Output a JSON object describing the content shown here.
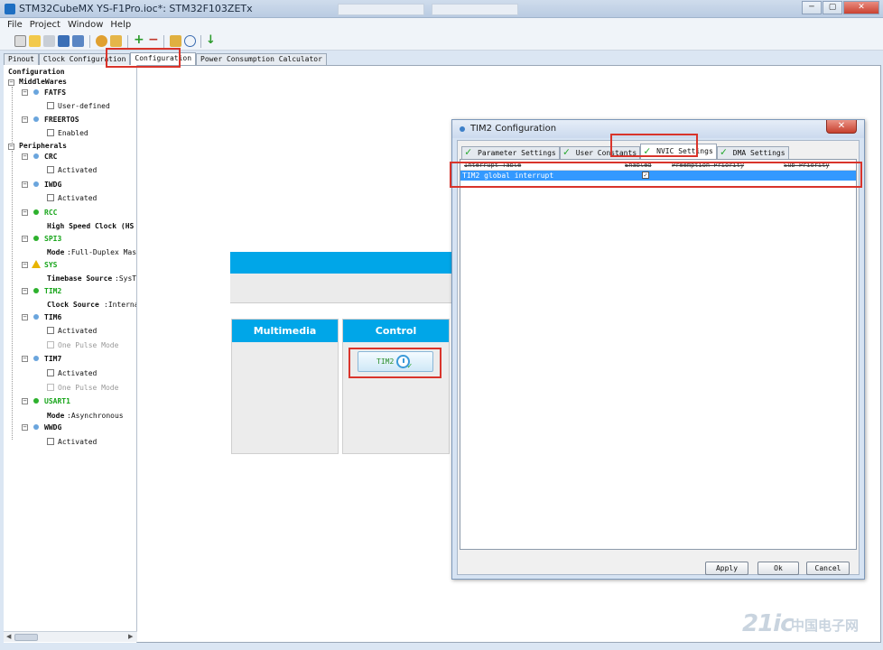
{
  "window": {
    "title": "STM32CubeMX YS-F1Pro.ioc*: STM32F103ZETx",
    "buttons": [
      "─",
      "▢",
      "✕"
    ]
  },
  "menu": [
    "File",
    "Project",
    "Window",
    "Help"
  ],
  "tabs": [
    "Pinout",
    "Clock Configuration",
    "Configuration",
    "Power Consumption Calculator"
  ],
  "tree": {
    "root": "Configuration",
    "middlewares_label": "MiddleWares",
    "fatfs": "FATFS",
    "fatfs_option": "User-defined",
    "freertos": "FREERTOS",
    "freertos_option": "Enabled",
    "peripherals_label": "Peripherals",
    "crc": "CRC",
    "crc_option": "Activated",
    "iwdg": "IWDG",
    "iwdg_option": "Activated",
    "rcc": "RCC",
    "rcc_key": "High Speed Clock (HS",
    "spi3": "SPI3",
    "spi3_key": "Mode",
    "spi3_val": ":Full-Duplex Master",
    "sys": "SYS",
    "sys_key": "Timebase Source",
    "sys_val": ":SysTi",
    "tim2": "TIM2",
    "tim2_key": "Clock Source ",
    "tim2_val": ":Interna",
    "tim6": "TIM6",
    "tim6_opt1": "Activated",
    "tim6_opt2": "One Pulse Mode",
    "tim7": "TIM7",
    "tim7_opt1": "Activated",
    "tim7_opt2": "One Pulse Mode",
    "usart1": "USART1",
    "usart1_key": "Mode",
    "usart1_val": ":Asynchronous",
    "wwdg": "WWDG",
    "wwdg_option": "Activated"
  },
  "canvas": {
    "multimedia_label": "Multimedia",
    "control_label": "Control",
    "tim2_button": "TIM2"
  },
  "dialog": {
    "title": "TIM2 Configuration",
    "close": "✕",
    "tabs": [
      "Parameter Settings",
      "User Constants",
      "NVIC Settings",
      "DMA Settings"
    ],
    "columns": [
      "Interrupt Table",
      "Enabled",
      "Preemption Priority",
      "Sub Priority"
    ],
    "rows": [
      {
        "name": "TIM2 global interrupt",
        "enabled": "✓"
      }
    ],
    "apply": "Apply",
    "ok": "Ok",
    "cancel": "Cancel"
  },
  "watermark": {
    "text": "21ic",
    "cn": "中国电子网"
  }
}
